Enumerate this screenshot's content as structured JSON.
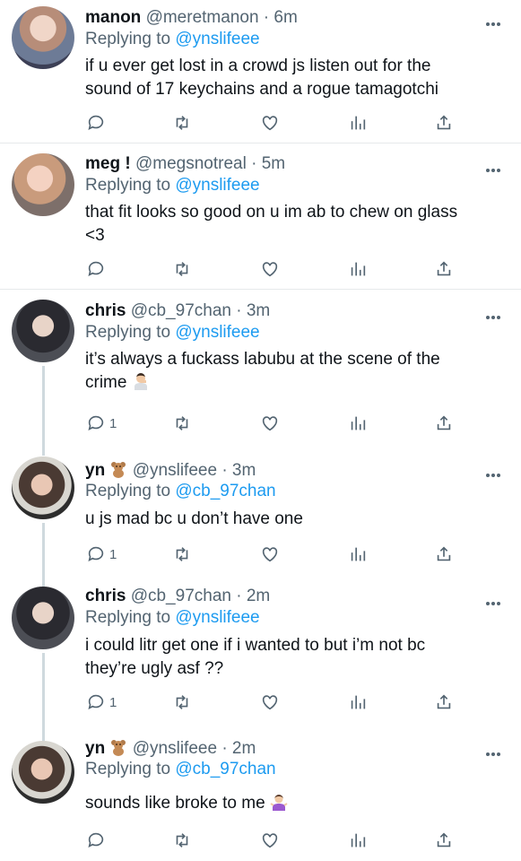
{
  "replying_label": "Replying to",
  "tweets": [
    {
      "name": "manon",
      "handle": "@meretmanon",
      "time": "6m",
      "reply_to": "@ynslifeee",
      "text": "if u ever get lost in a crowd js listen out for the sound of 17 keychains and a rogue tamagotchi",
      "reply_count": ""
    },
    {
      "name": "meg !",
      "handle": "@megsnotreal",
      "time": "5m",
      "reply_to": "@ynslifeee",
      "text": "that fit looks so good on u im ab to chew on glass <3",
      "reply_count": ""
    },
    {
      "name": "chris",
      "handle": "@cb_97chan",
      "time": "3m",
      "reply_to": "@ynslifeee",
      "text": "it’s always a fuckass labubu at the scene of the crime",
      "emoji": "man-facepalming-emoji",
      "reply_count": "1"
    },
    {
      "name": "yn",
      "name_emoji": "teddy-bear-emoji",
      "handle": "@ynslifeee",
      "time": "3m",
      "reply_to": "@cb_97chan",
      "text": "u js mad bc u don’t have one",
      "reply_count": "1"
    },
    {
      "name": "chris",
      "handle": "@cb_97chan",
      "time": "2m",
      "reply_to": "@ynslifeee",
      "text": "i could litr get one if i wanted to but i’m not bc they’re ugly asf ??",
      "reply_count": "1"
    },
    {
      "name": "yn",
      "name_emoji": "teddy-bear-emoji",
      "handle": "@ynslifeee",
      "time": "2m",
      "reply_to": "@cb_97chan",
      "text": "sounds like broke to me",
      "emoji": "woman-shrugging-emoji",
      "reply_count": ""
    }
  ],
  "colors": {
    "link": "#1d9bf0",
    "muted": "#536471",
    "text": "#0f1419",
    "divider": "#e6e9eb"
  },
  "icons": [
    "reply-icon",
    "retweet-icon",
    "like-icon",
    "views-icon",
    "share-icon",
    "more-icon"
  ]
}
